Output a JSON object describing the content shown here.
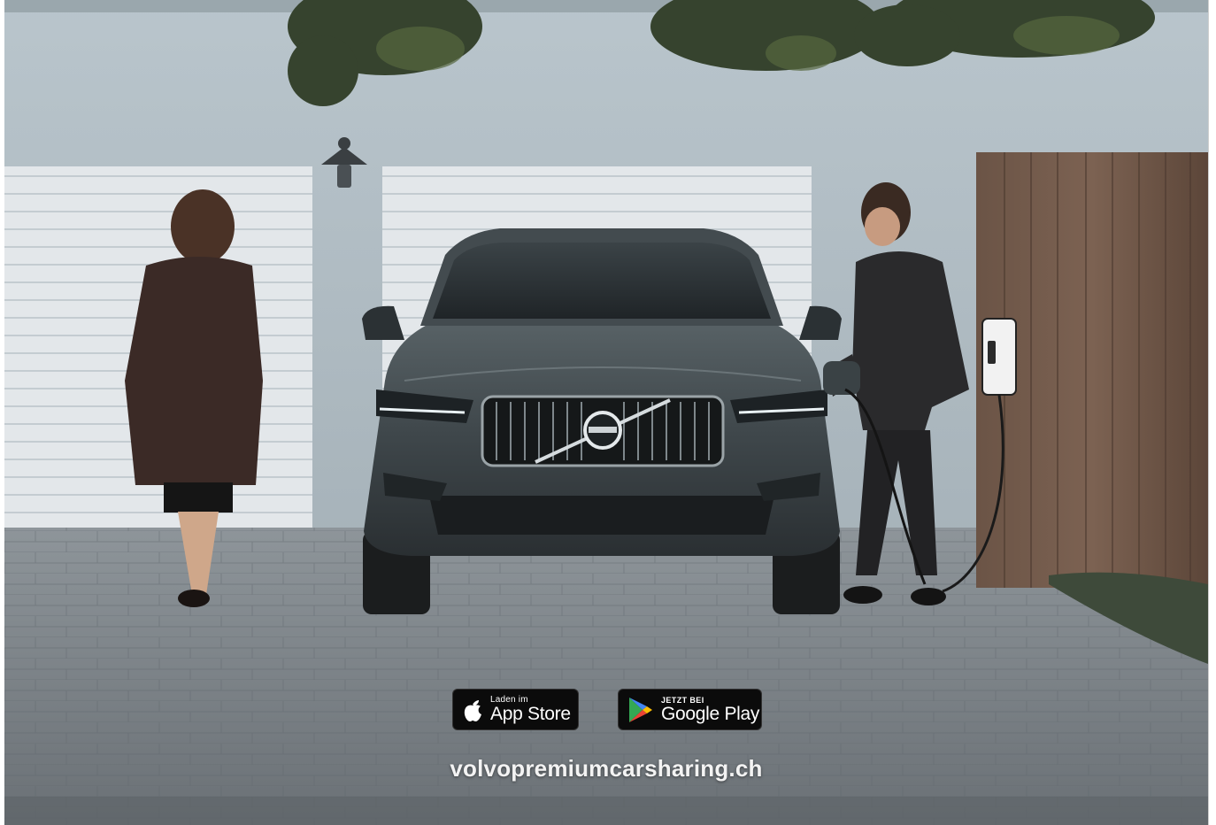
{
  "ad": {
    "photo": {
      "subject": "car-charging-scene"
    },
    "app_store_badge": {
      "small_text": "Laden im",
      "big_text": "App Store",
      "icon": "apple-icon"
    },
    "google_play_badge": {
      "small_text": "JETZT BEI",
      "big_text": "Google Play",
      "icon": "google-play-icon"
    },
    "website": "volvopremiumcarsharing.ch",
    "colors": {
      "badge_background": "#0b0b0b",
      "url_text": "#f3f3f3"
    }
  }
}
